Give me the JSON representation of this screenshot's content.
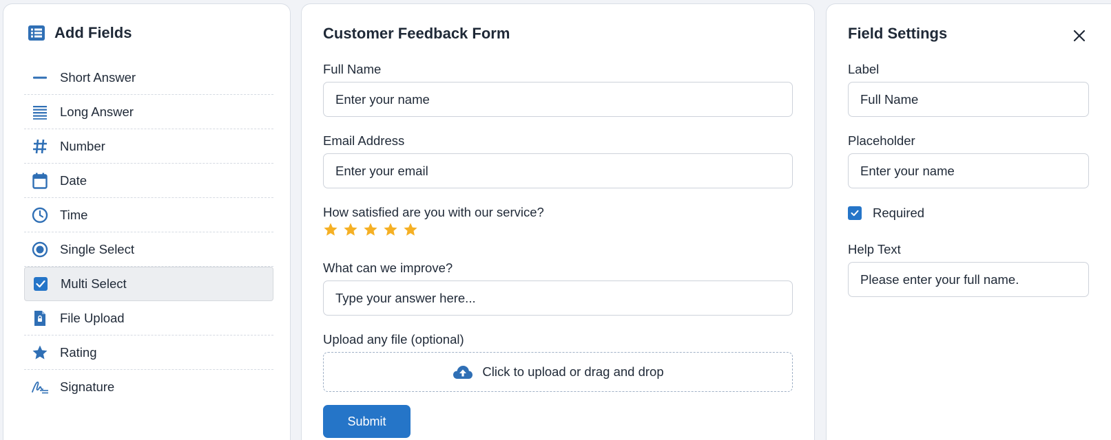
{
  "add_fields": {
    "title": "Add Fields",
    "items": [
      {
        "label": "Short Answer",
        "icon": "short-answer-icon"
      },
      {
        "label": "Long Answer",
        "icon": "long-answer-icon"
      },
      {
        "label": "Number",
        "icon": "hash-icon"
      },
      {
        "label": "Date",
        "icon": "calendar-icon"
      },
      {
        "label": "Time",
        "icon": "clock-icon"
      },
      {
        "label": "Single Select",
        "icon": "radio-icon"
      },
      {
        "label": "Multi Select",
        "icon": "checkbox-icon",
        "selected": true
      },
      {
        "label": "File Upload",
        "icon": "file-upload-icon"
      },
      {
        "label": "Rating",
        "icon": "star-icon"
      },
      {
        "label": "Signature",
        "icon": "signature-icon"
      }
    ]
  },
  "form": {
    "title": "Customer Feedback Form",
    "full_name": {
      "label": "Full Name",
      "placeholder": "Enter your name"
    },
    "email": {
      "label": "Email Address",
      "placeholder": "Enter your email"
    },
    "satisfaction": {
      "label": "How satisfied are you with our service?",
      "stars": 5
    },
    "improve": {
      "label": "What can we improve?",
      "placeholder": "Type your answer here..."
    },
    "upload": {
      "label": "Upload any file (optional)",
      "text": "Click to upload or drag and drop"
    },
    "submit_label": "Submit"
  },
  "settings": {
    "title": "Field Settings",
    "label_label": "Label",
    "label_value": "Full Name",
    "placeholder_label": "Placeholder",
    "placeholder_value": "Enter your name",
    "required_label": "Required",
    "required_checked": true,
    "help_label": "Help Text",
    "help_value": "Please enter your full name."
  },
  "colors": {
    "accent": "#2575c8",
    "icon_blue": "#2f6fb5",
    "star": "#f5b024"
  }
}
